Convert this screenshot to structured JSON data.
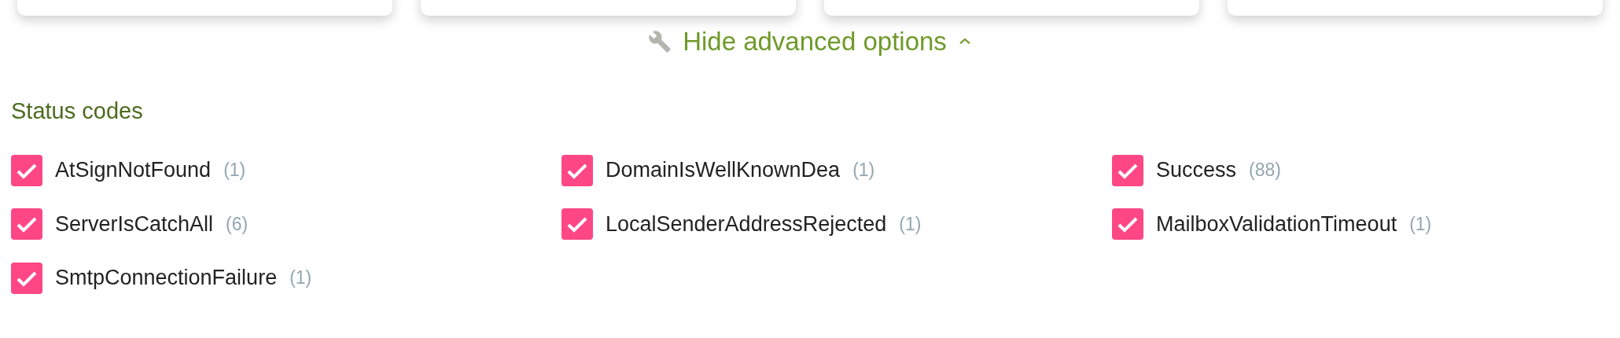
{
  "advanced_toggle": {
    "label": "Hide advanced options",
    "expanded": true
  },
  "section": {
    "title": "Status codes"
  },
  "status_codes": [
    {
      "label": "AtSignNotFound",
      "count": "(1)",
      "checked": true
    },
    {
      "label": "DomainIsWellKnownDea",
      "count": "(1)",
      "checked": true
    },
    {
      "label": "Success",
      "count": "(88)",
      "checked": true
    },
    {
      "label": "ServerIsCatchAll",
      "count": "(6)",
      "checked": true
    },
    {
      "label": "LocalSenderAddressRejected",
      "count": "(1)",
      "checked": true
    },
    {
      "label": "MailboxValidationTimeout",
      "count": "(1)",
      "checked": true
    },
    {
      "label": "SmtpConnectionFailure",
      "count": "(1)",
      "checked": true
    }
  ]
}
